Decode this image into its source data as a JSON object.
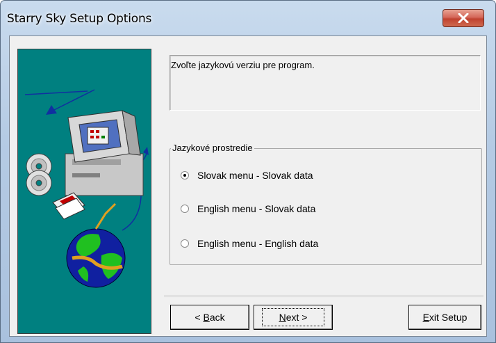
{
  "window": {
    "title": "Starry Sky Setup Options",
    "close_glyph": "x"
  },
  "instruction": {
    "text": "Zvoľte jazykovú verziu pre program."
  },
  "language_group": {
    "label": "Jazykové prostredie",
    "options": [
      {
        "label": "Slovak menu - Slovak data",
        "checked": true
      },
      {
        "label": "English menu - Slovak data",
        "checked": false
      },
      {
        "label": "English menu - English data",
        "checked": false
      }
    ]
  },
  "buttons": {
    "back": {
      "prefix": "< ",
      "mnemonic": "B",
      "rest": "ack"
    },
    "next": {
      "mnemonic": "N",
      "rest": "ext >"
    },
    "exit": {
      "mnemonic": "E",
      "rest": "xit Setup"
    }
  },
  "illustration": {
    "icons": [
      "computer-icon",
      "cd-disc-icon",
      "floppy-disk-icon",
      "globe-icon"
    ]
  },
  "colors": {
    "panel_background": "#008080",
    "dialog_background": "#f0f0f0",
    "close_button": "#c0422f"
  }
}
